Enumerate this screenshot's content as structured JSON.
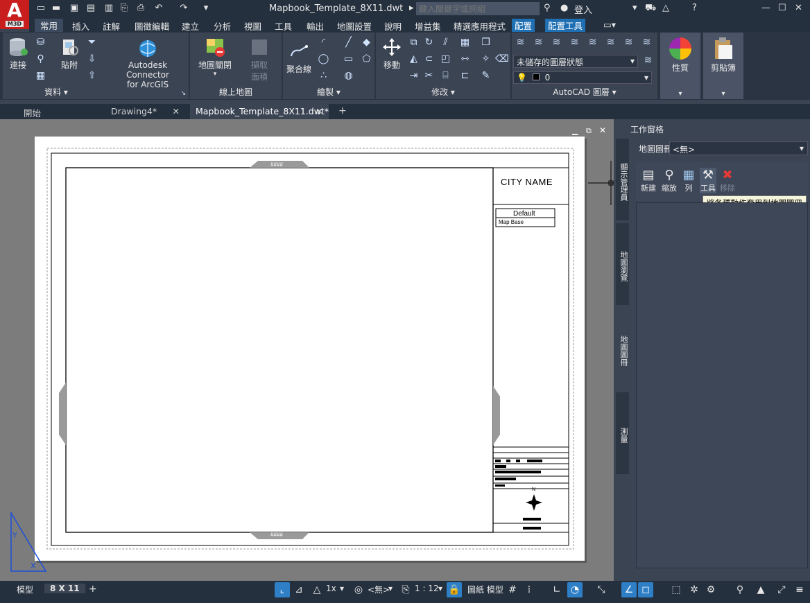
{
  "app": {
    "logo_letter": "A",
    "version_badge": "M3D"
  },
  "title": {
    "document": "Mapbook_Template_8X11.dwt",
    "search_placeholder": "鍵入關鍵字或詞組",
    "sign_in": "登入"
  },
  "menu": [
    "常用",
    "插入",
    "註解",
    "圖徵編輯",
    "建立",
    "分析",
    "視圖",
    "工具",
    "輸出",
    "地圖設置",
    "說明",
    "增益集",
    "精選應用程式",
    "配置",
    "配置工具"
  ],
  "ribbon": {
    "data_panel": {
      "connect": "連接",
      "attach": "貼附",
      "label": "資料"
    },
    "connector": {
      "line1": "Autodesk Connector",
      "line2": "for ArcGIS"
    },
    "map_panel": {
      "open": "地圖關閉",
      "extract": "擷取",
      "extract2": "面積",
      "label": "線上地圖"
    },
    "draw_panel": {
      "polyline": "聚合線",
      "label": "繪製"
    },
    "modify_panel": {
      "move": "移動",
      "label": "修改"
    },
    "layers_panel": {
      "state": "未儲存的圖層狀態",
      "layer": "0",
      "label": "AutoCAD 圖層"
    },
    "properties": {
      "label": "性質"
    },
    "clipboard": {
      "label": "剪貼簿"
    }
  },
  "tabs": [
    {
      "label": "開始"
    },
    {
      "label": "Drawing4*"
    },
    {
      "label": "Mapbook_Template_8X11.dwt*"
    }
  ],
  "drawing": {
    "city_name": "CITY NAME",
    "legend_title": "Default",
    "legend_item": "Map Base",
    "hash_top": "####",
    "hash_bottom": "####",
    "north": "N"
  },
  "palette": {
    "title": "工作窗格",
    "mapbook_label": "地圖圖冊",
    "mapbook_value": "<無>",
    "tools": [
      {
        "label": "新建"
      },
      {
        "label": "縮放"
      },
      {
        "label": "列"
      },
      {
        "label": "工具"
      },
      {
        "label": "移除"
      }
    ],
    "tooltip": "將各種動作套用到地圖圖冊",
    "side_tabs": [
      "顯示管理員",
      "地圖瀏覽",
      "地圖圖冊",
      "測量"
    ]
  },
  "status": {
    "model_tab": "模型",
    "layout_tab": "8 X 11",
    "scale_anno": "1x",
    "coord": "<無>",
    "viewport_scale": "1 : 12",
    "paper_model": "圖紙 模型"
  }
}
